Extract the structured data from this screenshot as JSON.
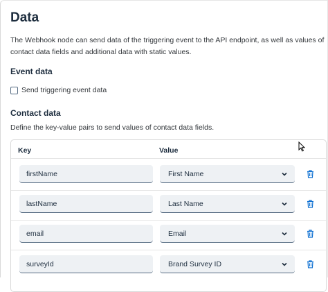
{
  "title": "Data",
  "description": "The Webhook node can send data of the triggering event to the API endpoint, as well as values of contact data fields and additional data with static values.",
  "event_data": {
    "heading": "Event data",
    "checkbox_label": "Send triggering event data",
    "checked": false
  },
  "contact_data": {
    "heading": "Contact data",
    "description": "Define the key-value pairs to send values of contact data fields.",
    "columns": {
      "key": "Key",
      "value": "Value"
    },
    "rows": [
      {
        "key": "firstName",
        "value": "First Name"
      },
      {
        "key": "lastName",
        "value": "Last Name"
      },
      {
        "key": "email",
        "value": "Email"
      },
      {
        "key": "surveyId",
        "value": "Brand Survey ID"
      }
    ]
  },
  "colors": {
    "accent": "#0a6ed1",
    "field_bg": "#eef1f4",
    "field_border": "#556b82"
  },
  "icons": {
    "dropdown": "chevron-down-icon",
    "delete": "trash-icon",
    "pointer": "mouse-pointer-icon"
  }
}
